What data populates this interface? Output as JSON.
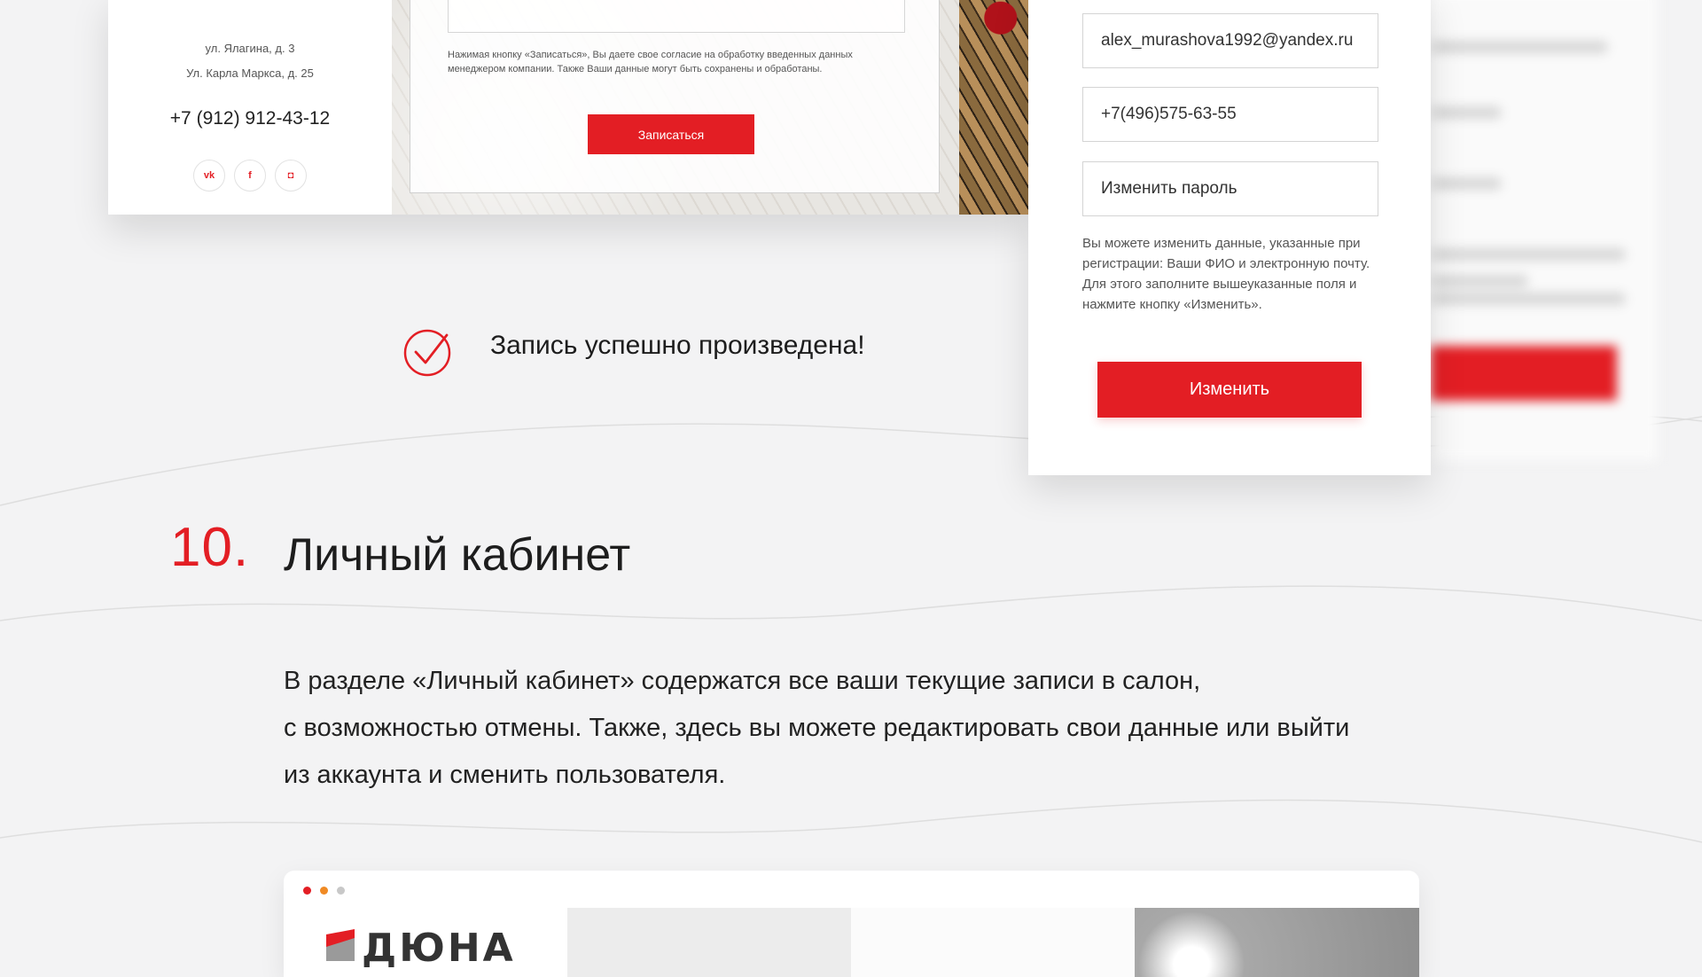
{
  "booking": {
    "address_1": "ул. Ялагина, д. 3",
    "address_2": "Ул. Карла Маркса, д. 25",
    "phone": "+7 (912) 912-43-12",
    "socials": [
      {
        "icon": "vk-icon",
        "glyph": "vk"
      },
      {
        "icon": "facebook-icon",
        "glyph": "f"
      },
      {
        "icon": "instagram-icon",
        "glyph": "◘"
      }
    ],
    "consent_text": "Нажимая кнопку «Записаться», Вы даете свое согласие на обработку введенных данных менеджером компании. Также Ваши данные могут быть сохранены и обработаны.",
    "signup_label": "Записаться"
  },
  "success": {
    "message": "Запись успешно произведена!"
  },
  "profile": {
    "email_value": "alex_murashova1992@yandex.ru",
    "phone_value": "+7(496)575-63-55",
    "password_placeholder": "Изменить пароль",
    "hint": "Вы можете изменить данные, указанные при регистрации: Ваши ФИО и электронную почту. Для этого заполните вышеуказанные поля и нажмите кнопку «Изменить».",
    "change_label": "Изменить"
  },
  "section": {
    "number": "10.",
    "title": "Личный кабинет",
    "desc_lines": [
      "В разделе «Личный кабинет» содержатся все ваши текущие записи в салон,",
      "с возможностью отмены. Также, здесь вы можете редактировать свои данные или выйти",
      "из аккаунта и сменить пользователя."
    ]
  },
  "browser_mock": {
    "logo_text": "ДЮНА"
  },
  "colors": {
    "accent": "#e31e24",
    "background": "#f3f3f4",
    "dot_orange": "#f08a24"
  }
}
